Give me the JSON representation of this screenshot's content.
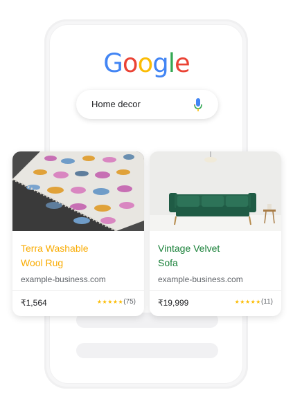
{
  "logo": {
    "letters": [
      "G",
      "o",
      "o",
      "g",
      "l",
      "e"
    ],
    "colors": [
      "#4285F4",
      "#EA4335",
      "#FBBC05",
      "#4285F4",
      "#34A853",
      "#EA4335"
    ]
  },
  "search": {
    "query": "Home decor",
    "icon": "mic-icon"
  },
  "products": [
    {
      "title_line1": "Terra Washable",
      "title_line2": "Wool Rug",
      "title_color": "#F9AB00",
      "site": "example-business.com",
      "price": "₹1,564",
      "stars": "★★★★★",
      "reviews": "(75)"
    },
    {
      "title_line1": "Vintage Velvet",
      "title_line2": "Sofa",
      "title_color": "#188038",
      "site": "example-business.com",
      "price": "₹19,999",
      "stars": "★★★★★",
      "reviews": "(11)"
    }
  ]
}
